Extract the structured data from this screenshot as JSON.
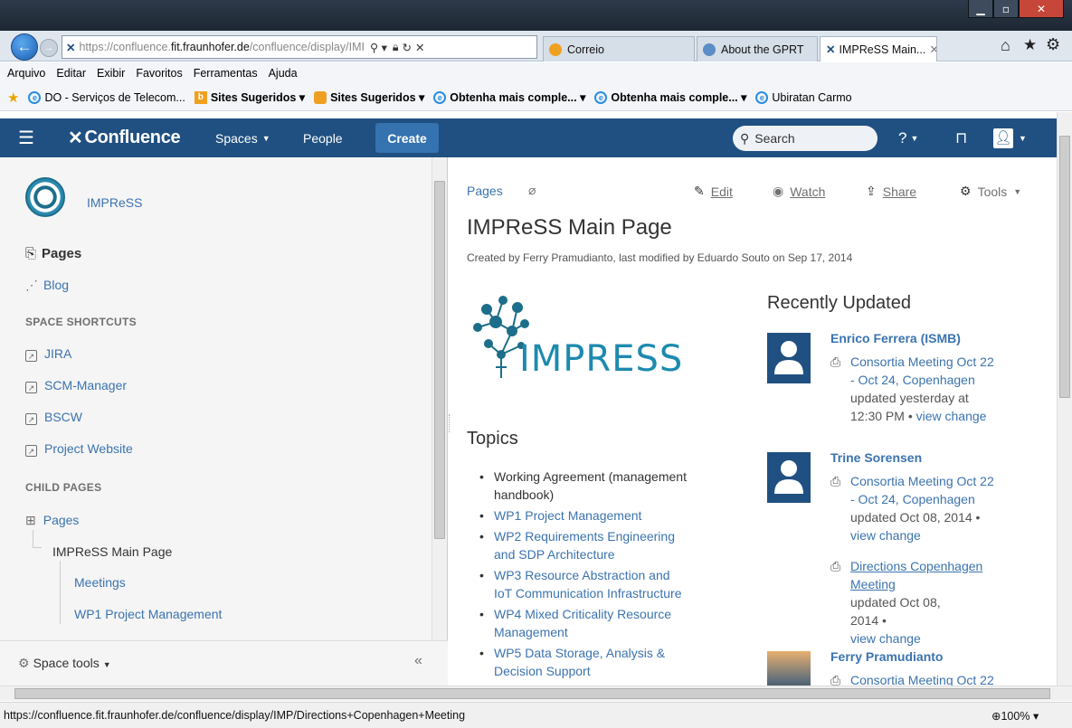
{
  "browser": {
    "address": {
      "prefix": "https://confluence.",
      "domain": "fit.fraunhofer.de",
      "suffix": "/confluence/display/IMI"
    },
    "tabs": [
      {
        "label": "Correio"
      },
      {
        "label": "About the GPRT"
      },
      {
        "label": "IMPReSS Main..."
      }
    ],
    "menu": [
      "Arquivo",
      "Editar",
      "Exibir",
      "Favoritos",
      "Ferramentas",
      "Ajuda"
    ],
    "favorites": [
      {
        "label": "DO - Serviços de Telecom..."
      },
      {
        "label": "Sites Sugeridos ▾"
      },
      {
        "label": "Sites Sugeridos ▾"
      },
      {
        "label": "Obtenha mais comple... ▾"
      },
      {
        "label": "Obtenha mais comple... ▾"
      },
      {
        "label": "Ubiratan Carmo"
      }
    ],
    "status_url": "https://confluence.fit.fraunhofer.de/confluence/display/IMP/Directions+Copenhagen+Meeting",
    "zoom": "100%"
  },
  "header": {
    "logo": "Confluence",
    "spaces": "Spaces",
    "people": "People",
    "create": "Create",
    "search_placeholder": "Search"
  },
  "sidebar": {
    "space_name": "IMPReSS",
    "pages": "Pages",
    "blog": "Blog",
    "shortcuts_heading": "SPACE SHORTCUTS",
    "shortcuts": [
      "JIRA",
      "SCM-Manager",
      "BSCW",
      "Project Website"
    ],
    "child_heading": "CHILD PAGES",
    "child_pages": "Pages",
    "current_page": "IMPReSS Main Page",
    "children": [
      "Meetings",
      "WP1 Project Management"
    ],
    "space_tools": "Space tools",
    "collapse": "«"
  },
  "page": {
    "breadcrumb": "Pages",
    "edit": "Edit",
    "watch": "Watch",
    "share": "Share",
    "tools": "Tools",
    "title": "IMPReSS Main Page",
    "byline": "Created by Ferry Pramudianto, last modified by Eduardo Souto on Sep 17, 2014",
    "logo_text": "IMPRESS",
    "topics_heading": "Topics",
    "topics": [
      {
        "lines": [
          "Working Agreement (management",
          "handbook)"
        ],
        "link": false
      },
      {
        "lines": [
          "WP1 Project Management"
        ],
        "link": true
      },
      {
        "lines": [
          "WP2 Requirements Engineering",
          "and SDP Architecture"
        ],
        "link": true
      },
      {
        "lines": [
          "WP3 Resource Abstraction and",
          "IoT Communication Infrastructure"
        ],
        "link": true
      },
      {
        "lines": [
          "WP4 Mixed Criticality Resource",
          "Management"
        ],
        "link": true
      },
      {
        "lines": [
          "WP5 Data Storage, Analysis &",
          "Decision Support"
        ],
        "link": true
      }
    ],
    "recent_heading": "Recently Updated",
    "recent": [
      {
        "user": "Enrico Ferrera (ISMB)",
        "items": [
          {
            "title": [
              "Consortia Meeting Oct 22",
              "- Oct 24, Copenhagen"
            ],
            "meta": [
              "updated yesterday at",
              "12:30 PM •"
            ],
            "change": "view change"
          }
        ]
      },
      {
        "user": "Trine Sorensen",
        "items": [
          {
            "title": [
              "Consortia Meeting Oct 22",
              "- Oct 24, Copenhagen"
            ],
            "meta": [
              "updated Oct 08, 2014 •"
            ],
            "change": "view change"
          },
          {
            "title": [
              "Directions Copenhagen",
              "Meeting"
            ],
            "meta": [
              "updated Oct 08,",
              "2014 •"
            ],
            "change": "view change"
          }
        ]
      },
      {
        "user": "Ferry Pramudianto",
        "items": [
          {
            "title": [
              "Consortia Meeting Oct 22"
            ],
            "meta": [],
            "change": ""
          }
        ]
      }
    ]
  }
}
